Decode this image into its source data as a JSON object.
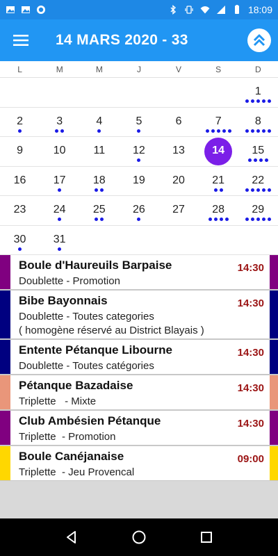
{
  "status_bar": {
    "time": "18:09",
    "left_icons": [
      "image-icon",
      "image-icon",
      "circle-app-icon"
    ],
    "right_icons": [
      "bluetooth-icon",
      "vibrate-icon",
      "wifi-icon",
      "signal-icon",
      "battery-icon"
    ]
  },
  "app_bar": {
    "title": "14 MARS 2020 - 33",
    "menu_icon": "hamburger-menu-icon",
    "action_icon": "double-chevron-up-icon"
  },
  "colors": {
    "status_bar": "#1e88e5",
    "app_bar": "#2196f3",
    "selected_day": "#7b1fe8",
    "dot": "#1a1ae6",
    "time_text": "#9b1414"
  },
  "calendar": {
    "weekdays": [
      "L",
      "M",
      "M",
      "J",
      "V",
      "S",
      "D"
    ],
    "selected_day": "14",
    "weeks": [
      [
        {
          "day": "",
          "dots": 0
        },
        {
          "day": "",
          "dots": 0
        },
        {
          "day": "",
          "dots": 0
        },
        {
          "day": "",
          "dots": 0
        },
        {
          "day": "",
          "dots": 0
        },
        {
          "day": "",
          "dots": 0
        },
        {
          "day": "1",
          "dots": 5
        }
      ],
      [
        {
          "day": "2",
          "dots": 1
        },
        {
          "day": "3",
          "dots": 2
        },
        {
          "day": "4",
          "dots": 1
        },
        {
          "day": "5",
          "dots": 1
        },
        {
          "day": "6",
          "dots": 0
        },
        {
          "day": "7",
          "dots": 5
        },
        {
          "day": "8",
          "dots": 5
        }
      ],
      [
        {
          "day": "9",
          "dots": 0
        },
        {
          "day": "10",
          "dots": 0
        },
        {
          "day": "11",
          "dots": 0
        },
        {
          "day": "12",
          "dots": 1
        },
        {
          "day": "13",
          "dots": 0
        },
        {
          "day": "14",
          "dots": 0,
          "selected": true
        },
        {
          "day": "15",
          "dots": 4
        }
      ],
      [
        {
          "day": "16",
          "dots": 0
        },
        {
          "day": "17",
          "dots": 1
        },
        {
          "day": "18",
          "dots": 2
        },
        {
          "day": "19",
          "dots": 0
        },
        {
          "day": "20",
          "dots": 0
        },
        {
          "day": "21",
          "dots": 2
        },
        {
          "day": "22",
          "dots": 5
        }
      ],
      [
        {
          "day": "23",
          "dots": 0
        },
        {
          "day": "24",
          "dots": 1
        },
        {
          "day": "25",
          "dots": 2
        },
        {
          "day": "26",
          "dots": 1
        },
        {
          "day": "27",
          "dots": 0
        },
        {
          "day": "28",
          "dots": 4
        },
        {
          "day": "29",
          "dots": 5
        }
      ],
      [
        {
          "day": "30",
          "dots": 1
        },
        {
          "day": "31",
          "dots": 1
        },
        {
          "day": "",
          "dots": 0
        },
        {
          "day": "",
          "dots": 0
        },
        {
          "day": "",
          "dots": 0
        },
        {
          "day": "",
          "dots": 0
        },
        {
          "day": "",
          "dots": 0
        }
      ]
    ]
  },
  "events": [
    {
      "title": "Boule d'Haureuils Barpaise",
      "line1": "Doublette - Promotion",
      "line2": "",
      "time": "14:30",
      "color": "#800080"
    },
    {
      "title": "Bibe Bayonnais",
      "line1": "Doublette - Toutes categories",
      "line2": "( homogène réservé au District Blayais )",
      "time": "14:30",
      "color": "#000080"
    },
    {
      "title": "Entente Pétanque Libourne",
      "line1": "Doublette - Toutes catégories",
      "line2": "",
      "time": "14:30",
      "color": "#000080"
    },
    {
      "title": "Pétanque Bazadaise",
      "line1": "Triplette   - Mixte",
      "line2": "",
      "time": "14:30",
      "color": "#e9967a"
    },
    {
      "title": "Club Ambésien Pétanque",
      "line1": "Triplette  - Promotion",
      "line2": "",
      "time": "14:30",
      "color": "#800080"
    },
    {
      "title": "Boule Canéjanaise",
      "line1": "Triplette  - Jeu Provencal",
      "line2": "",
      "time": "09:00",
      "color": "#ffd700"
    }
  ],
  "nav_bar": {
    "icons": [
      "back-triangle-icon",
      "home-circle-icon",
      "recents-square-icon"
    ]
  }
}
